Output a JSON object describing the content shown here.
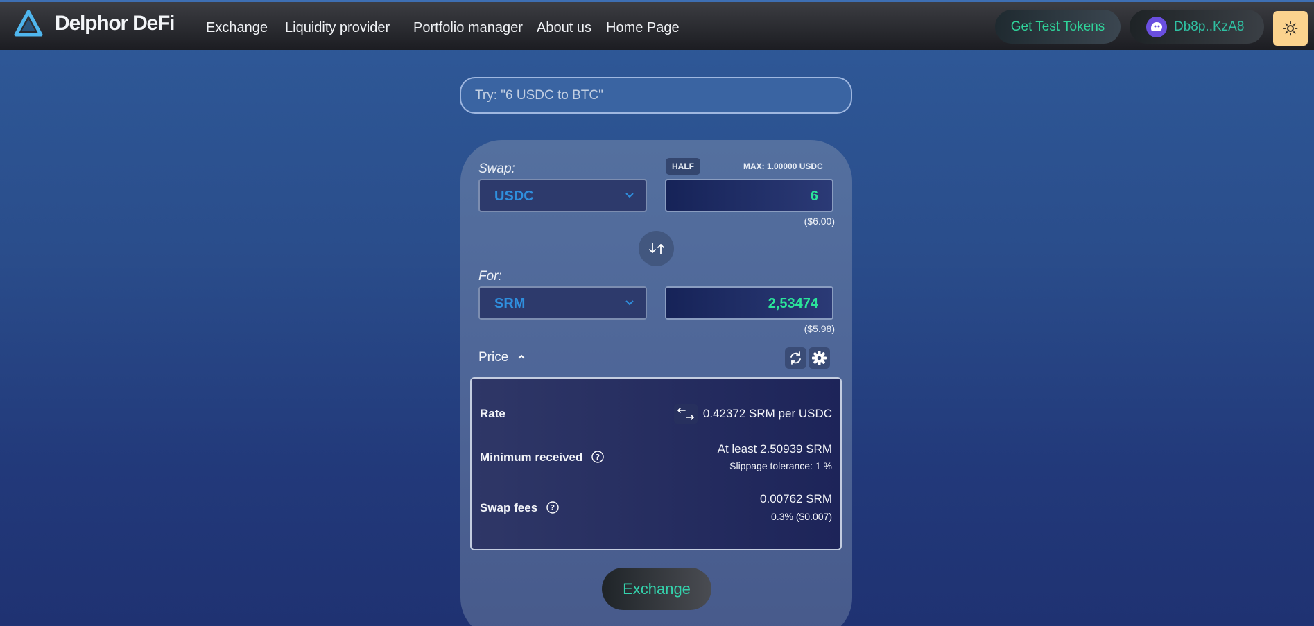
{
  "header": {
    "brand": "Delphor DeFi",
    "nav": [
      "Exchange",
      "Liquidity provider",
      "Portfolio manager",
      "About us",
      "Home Page"
    ],
    "get_tokens_label": "Get Test Tokens",
    "wallet_label": "Db8p..KzA8"
  },
  "search": {
    "placeholder": "Try: \"6 USDC to BTC\""
  },
  "swap": {
    "swap_label": "Swap:",
    "half_label": "HALF",
    "max_label": "MAX: 1.00000 USDC",
    "from_token": "USDC",
    "from_amount": "6",
    "from_usd": "($6.00)",
    "for_label": "For:",
    "to_token": "SRM",
    "to_amount": "2,53474",
    "to_usd": "($5.98)"
  },
  "price": {
    "toggle_label": "Price",
    "rate_label": "Rate",
    "rate_value": "0.42372 SRM per USDC",
    "min_label": "Minimum received",
    "min_value": "At least 2.50939 SRM",
    "slippage": "Slippage tolerance: 1 %",
    "fees_label": "Swap fees",
    "fees_value": "0.00762 SRM",
    "fees_detail": "0.3% ($0.007)"
  },
  "actions": {
    "exchange_label": "Exchange"
  },
  "colors": {
    "accent_green": "#2be49a",
    "token_blue": "#2f8fde",
    "theme_button": "#fbd38e"
  }
}
